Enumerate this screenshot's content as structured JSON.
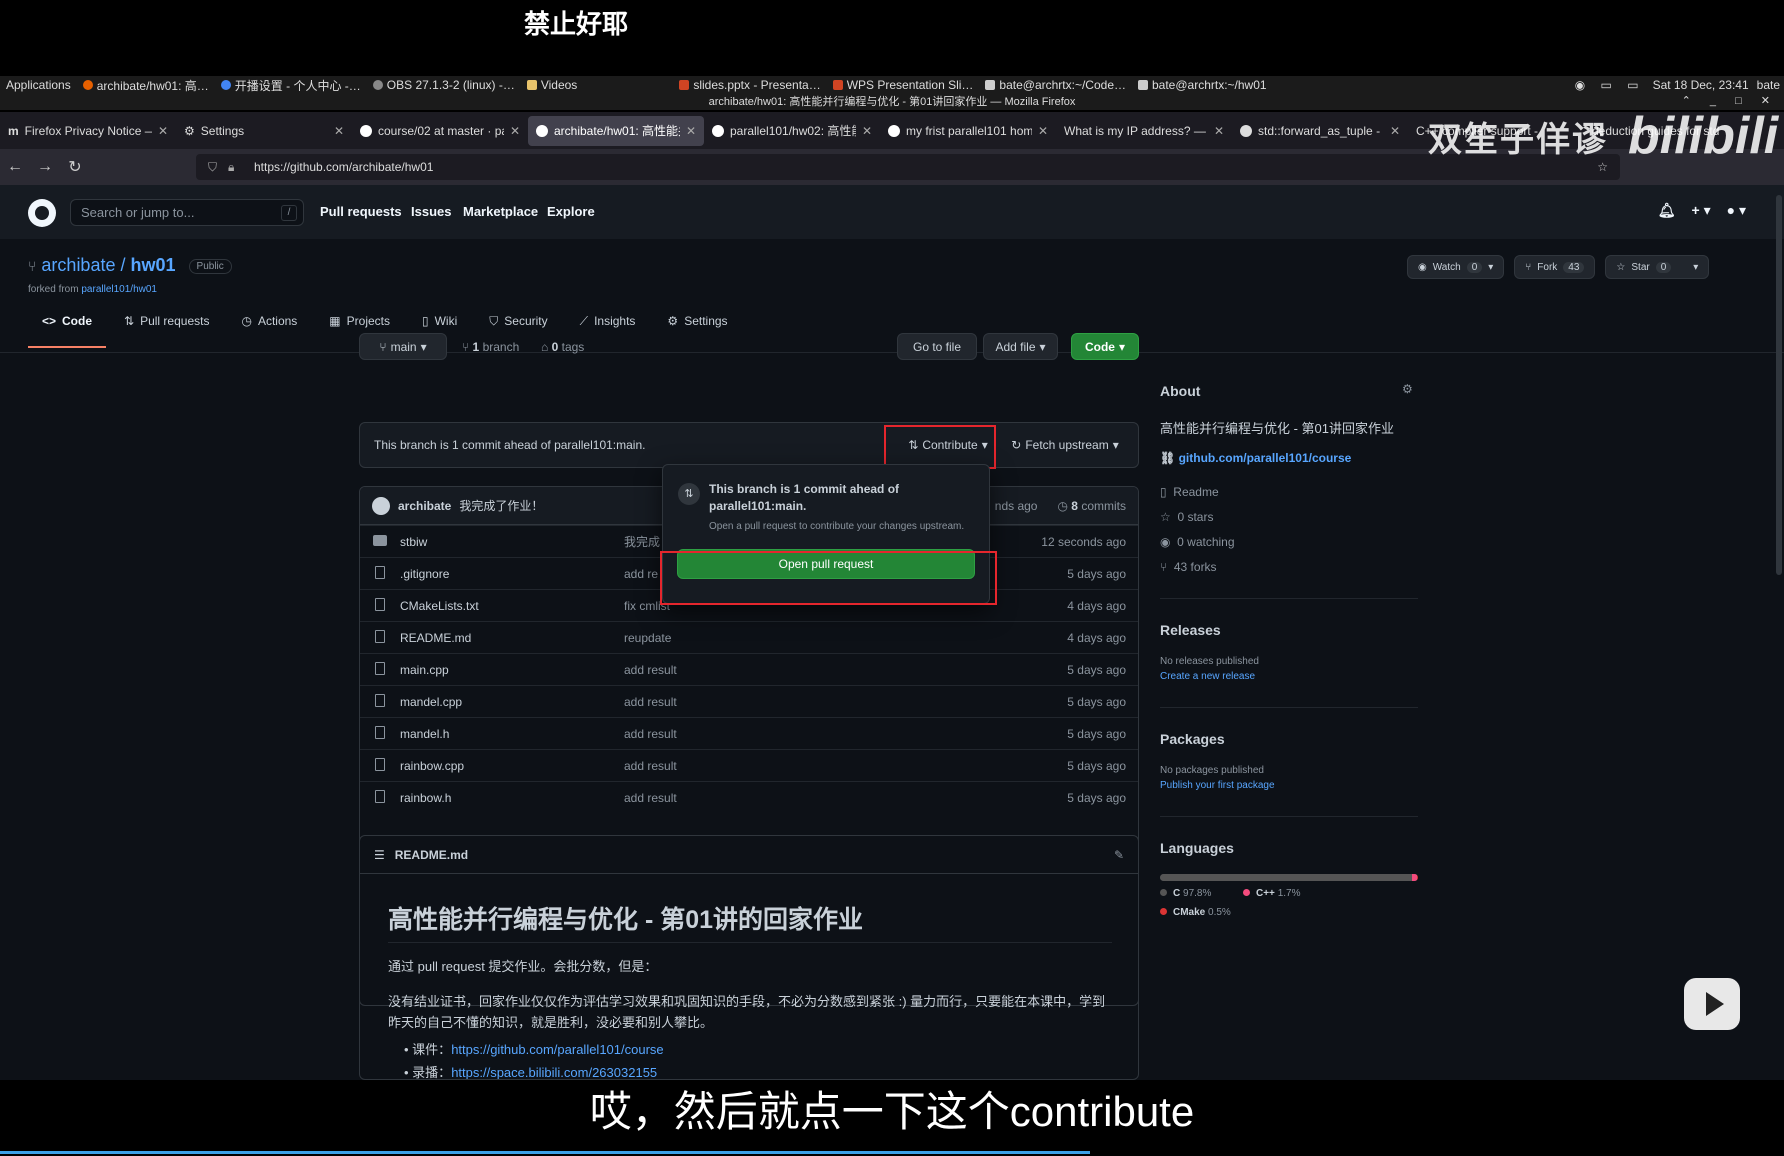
{
  "overlay": {
    "top_caption": "禁止好耶",
    "subtitle": "哎，然后就点一下这个contribute"
  },
  "taskbar": {
    "items": [
      "Applications",
      "archibate/hw01: 高…",
      "开播设置 - 个人中心 -…",
      "OBS 27.1.3-2 (linux) -…",
      "Videos",
      "slides.pptx - Presenta…",
      "WPS Presentation Sli…",
      "bate@archrtx:~/Code…",
      "bate@archrtx:~/hw01"
    ],
    "clock": "Sat 18 Dec, 23:41",
    "user": "bate"
  },
  "window": {
    "title": "archibate/hw01: 高性能并行编程与优化 - 第01讲回家作业 — Mozilla Firefox"
  },
  "browser": {
    "tabs": [
      {
        "label": "Firefox Privacy Notice —",
        "active": false
      },
      {
        "label": "Settings",
        "active": false
      },
      {
        "label": "course/02 at master · pa",
        "active": false
      },
      {
        "label": "archibate/hw01: 高性能并",
        "active": true
      },
      {
        "label": "parallel101/hw02: 高性能",
        "active": false
      },
      {
        "label": "my frist parallel101 home",
        "active": false
      },
      {
        "label": "What is my IP address? — I",
        "active": false
      },
      {
        "label": "std::forward_as_tuple - C",
        "active": false
      },
      {
        "label": "C++ compiler support -",
        "active": false
      },
      {
        "label": "deduction guides for std",
        "active": false
      }
    ],
    "url": "https://github.com/archibate/hw01"
  },
  "watermark": {
    "left": "双笙子佯谬",
    "right": "bilibili"
  },
  "github": {
    "header": {
      "search_placeholder": "Search or jump to...",
      "slash": "/",
      "links": [
        "Pull requests",
        "Issues",
        "Marketplace",
        "Explore"
      ]
    },
    "repo": {
      "owner": "archibate",
      "sep": " / ",
      "name": "hw01",
      "visibility": "Public",
      "forked_label": "forked from ",
      "forked_from": "parallel101/hw01",
      "watch_label": "Watch",
      "watch_count": "0",
      "fork_label": "Fork",
      "fork_count": "43",
      "star_label": "Star",
      "star_count": "0"
    },
    "nav": [
      "Code",
      "Pull requests",
      "Actions",
      "Projects",
      "Wiki",
      "Security",
      "Insights",
      "Settings"
    ],
    "branch": {
      "current": "main",
      "branches_count": "1",
      "branches_label": "branch",
      "tags_count": "0",
      "tags_label": "tags",
      "go_to_file": "Go to file",
      "add_file": "Add file",
      "code": "Code"
    },
    "ahead_message": "This branch is 1 commit ahead of parallel101:main.",
    "contribute_label": "Contribute",
    "fetch_upstream_label": "Fetch upstream",
    "popover": {
      "title": "This branch is 1 commit ahead of parallel101:main.",
      "subtitle": "Open a pull request to contribute your changes upstream.",
      "button": "Open pull request"
    },
    "latest_commit": {
      "author": "archibate",
      "message": "我完成了作业！",
      "time_fragment": "nds ago",
      "commits_count": "8",
      "commits_label": "commits"
    },
    "files": [
      {
        "name": "stbiw",
        "type": "dir",
        "message": "我完成",
        "date": "12 seconds ago"
      },
      {
        "name": ".gitignore",
        "type": "file",
        "message": "add re",
        "date": "5 days ago"
      },
      {
        "name": "CMakeLists.txt",
        "type": "file",
        "message": "fix cmlist",
        "date": "4 days ago"
      },
      {
        "name": "README.md",
        "type": "file",
        "message": "reupdate",
        "date": "4 days ago"
      },
      {
        "name": "main.cpp",
        "type": "file",
        "message": "add result",
        "date": "5 days ago"
      },
      {
        "name": "mandel.cpp",
        "type": "file",
        "message": "add result",
        "date": "5 days ago"
      },
      {
        "name": "mandel.h",
        "type": "file",
        "message": "add result",
        "date": "5 days ago"
      },
      {
        "name": "rainbow.cpp",
        "type": "file",
        "message": "add result",
        "date": "5 days ago"
      },
      {
        "name": "rainbow.h",
        "type": "file",
        "message": "add result",
        "date": "5 days ago"
      }
    ],
    "readme": {
      "filename": "README.md",
      "heading": "高性能并行编程与优化 - 第01讲的回家作业",
      "p1": "通过 pull request 提交作业。会批分数，但是：",
      "p2": "没有结业证书，回家作业仅仅作为评估学习效果和巩固知识的手段，不必为分数感到紧张 :) 量力而行，只要能在本课中，学到昨天的自己不懂的知识，就是胜利，没必要和别人攀比。",
      "bullet1_label": "课件：",
      "bullet1_link": "https://github.com/parallel101/course",
      "bullet2_label": "录播：",
      "bullet2_link": "https://space.bilibili.com/263032155"
    },
    "about": {
      "heading": "About",
      "description": "高性能并行编程与优化 - 第01讲回家作业",
      "link": "github.com/parallel101/course",
      "readme": "Readme",
      "stars": "0 stars",
      "watching": "0 watching",
      "forks": "43 forks"
    },
    "releases": {
      "heading": "Releases",
      "none": "No releases published",
      "create": "Create a new release"
    },
    "packages": {
      "heading": "Packages",
      "none": "No packages published",
      "publish": "Publish your first package"
    },
    "languages": {
      "heading": "Languages",
      "items": [
        {
          "name": "C",
          "percent": "97.8%",
          "value": 97.8,
          "color": "#555555"
        },
        {
          "name": "C++",
          "percent": "1.7%",
          "value": 1.7,
          "color": "#f34b7d"
        },
        {
          "name": "CMake",
          "percent": "0.5%",
          "value": 0.5,
          "color": "#da3434"
        }
      ]
    }
  }
}
